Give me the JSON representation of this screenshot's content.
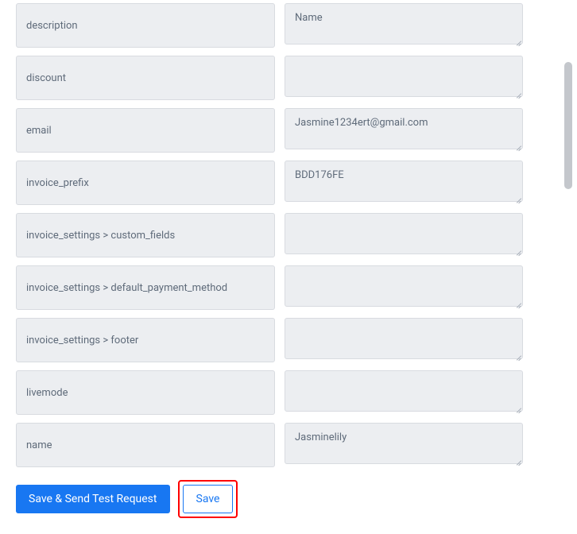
{
  "fields": [
    {
      "label": "description",
      "value": "Name"
    },
    {
      "label": "discount",
      "value": ""
    },
    {
      "label": "email",
      "value": "Jasmine1234ert@gmail.com"
    },
    {
      "label": "invoice_prefix",
      "value": "BDD176FE"
    },
    {
      "label": "invoice_settings > custom_fields",
      "value": ""
    },
    {
      "label": "invoice_settings > default_payment_method",
      "value": ""
    },
    {
      "label": "invoice_settings > footer",
      "value": ""
    },
    {
      "label": "livemode",
      "value": ""
    },
    {
      "label": "name",
      "value": "Jasminelily"
    }
  ],
  "buttons": {
    "save_send": "Save & Send Test Request",
    "save": "Save"
  }
}
